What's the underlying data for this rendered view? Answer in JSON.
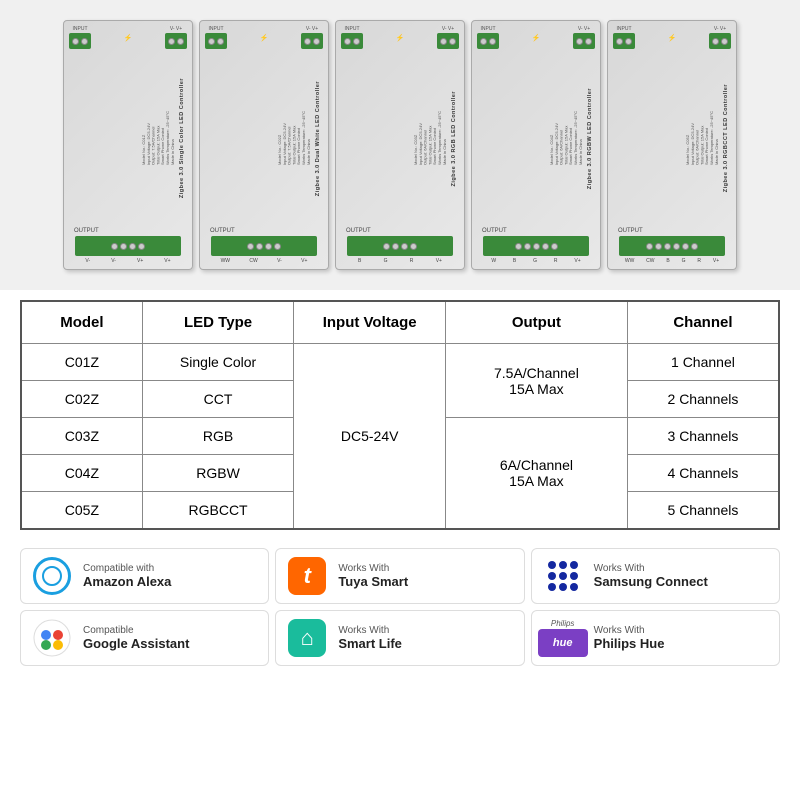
{
  "products": [
    {
      "id": "C01Z",
      "name": "Zigbee 3.0 Single Color LED Controller",
      "outputs": [
        "V-",
        "V-",
        "V+",
        "V+"
      ],
      "color": "single"
    },
    {
      "id": "C02Z",
      "name": "Zigbee 3.0 Dual White LED Controller",
      "outputs": [
        "WW",
        "CW",
        "V-",
        "V+"
      ],
      "color": "dual"
    },
    {
      "id": "C03Z",
      "name": "Zigbee 3.0 RGB LED Controller",
      "outputs": [
        "B",
        "G",
        "R",
        "V+"
      ],
      "color": "rgb"
    },
    {
      "id": "C04Z",
      "name": "Zigbee 3.0 RGBW LED Controller",
      "outputs": [
        "W",
        "B",
        "G",
        "R",
        "V+"
      ],
      "color": "rgbw"
    },
    {
      "id": "C05Z",
      "name": "Zigbee 3.0 RGBCCT LED Controller",
      "outputs": [
        "WW",
        "CW",
        "B",
        "G",
        "R",
        "V+"
      ],
      "color": "rgbcct"
    }
  ],
  "table": {
    "headers": [
      "Model",
      "LED Type",
      "Input Voltage",
      "Output",
      "Channel"
    ],
    "rows": [
      {
        "model": "C01Z",
        "led": "Single Color",
        "voltage": "DC5-24V",
        "output": "7.5A/Channel\n15A Max",
        "channel": "1 Channel"
      },
      {
        "model": "C02Z",
        "led": "CCT",
        "voltage": "DC5-24V",
        "output": "7.5A/Channel\n15A Max",
        "channel": "2 Channels"
      },
      {
        "model": "C03Z",
        "led": "RGB",
        "voltage": "DC5-24V",
        "output": "6A/Channel\n15A Max",
        "channel": "3 Channels"
      },
      {
        "model": "C04Z",
        "led": "RGBW",
        "voltage": "DC5-24V",
        "output": "6A/Channel\n15A Max",
        "channel": "4 Channels"
      },
      {
        "model": "C05Z",
        "led": "RGBCCT",
        "voltage": "DC5-24V",
        "output": "6A/Channel\n15A Max",
        "channel": "5 Channels"
      }
    ],
    "voltage_rowspan": "DC5-24V",
    "output_group1": "7.5A/Channel\n15A Max",
    "output_group2": "6A/Channel\n15A Max"
  },
  "compatibility": [
    {
      "id": "alexa",
      "works_with": "Compatible with",
      "name": "Amazon Alexa",
      "icon_type": "alexa"
    },
    {
      "id": "tuya",
      "works_with": "Works With",
      "name": "Tuya Smart",
      "icon_type": "tuya"
    },
    {
      "id": "samsung",
      "works_with": "Works With",
      "name": "Samsung Connect",
      "icon_type": "samsung"
    },
    {
      "id": "google",
      "works_with": "Compatible",
      "name": "Google Assistant",
      "icon_type": "google"
    },
    {
      "id": "smartlife",
      "works_with": "Works With",
      "name": "Smart Life",
      "icon_type": "smartlife"
    },
    {
      "id": "hue",
      "works_with": "Works With",
      "name": "Philips Hue",
      "icon_type": "hue"
    }
  ]
}
